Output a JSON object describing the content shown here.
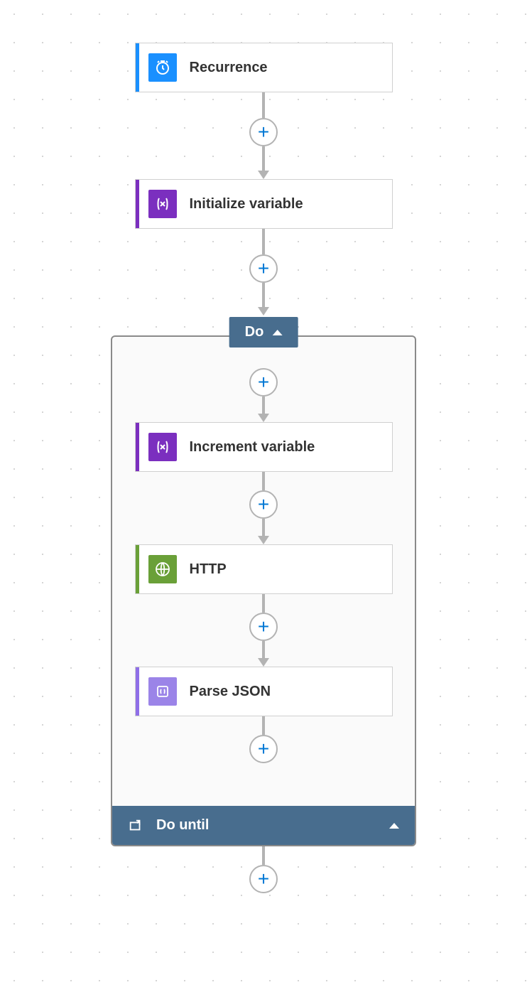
{
  "flow": {
    "steps": [
      {
        "label": "Recurrence",
        "icon": "clock",
        "accent": "#1a90ff",
        "iconbg": "#1a90ff"
      },
      {
        "label": "Initialize variable",
        "icon": "varx",
        "accent": "#7b2fbf",
        "iconbg": "#7b2fbf"
      }
    ],
    "loop": {
      "tab_label": "Do",
      "footer_label": "Do until",
      "steps": [
        {
          "label": "Increment variable",
          "icon": "varx",
          "accent": "#7b2fbf",
          "iconbg": "#7b2fbf"
        },
        {
          "label": "HTTP",
          "icon": "globe",
          "accent": "#6aa038",
          "iconbg": "#6aa038"
        },
        {
          "label": "Parse JSON",
          "icon": "databox",
          "accent": "#8f6fe8",
          "iconbg": "#9b84e8"
        }
      ]
    }
  },
  "colors": {
    "loop_bg": "#486d8e",
    "plus": "#0078d4"
  }
}
